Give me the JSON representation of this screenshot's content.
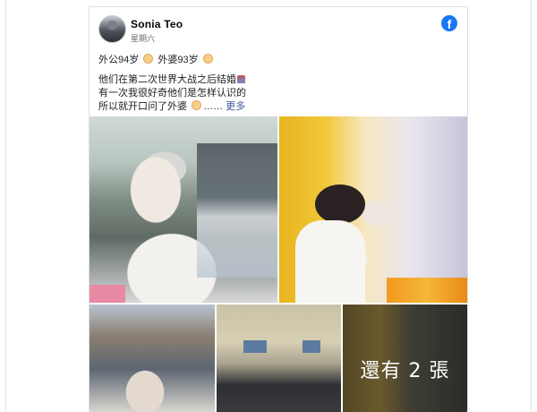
{
  "post": {
    "author": "Sonia Teo",
    "timestamp": "星期六",
    "text_line1_a": "外公94岁",
    "text_line1_b": "外婆93岁",
    "text_line2": "他们在第二次世界大战之后结婚",
    "text_line3": "有一次我很好奇他们是怎样认识的",
    "text_line4": "所以就开口问了外婆",
    "ellipsis": "……",
    "more_link": "更多",
    "more_photos_overlay": "還有 2 張"
  },
  "platform": {
    "badge_letter": "f",
    "brand_color": "#1877f2"
  },
  "icons": [
    "facebook-icon",
    "elderly-face-emoji",
    "church-emoji"
  ]
}
